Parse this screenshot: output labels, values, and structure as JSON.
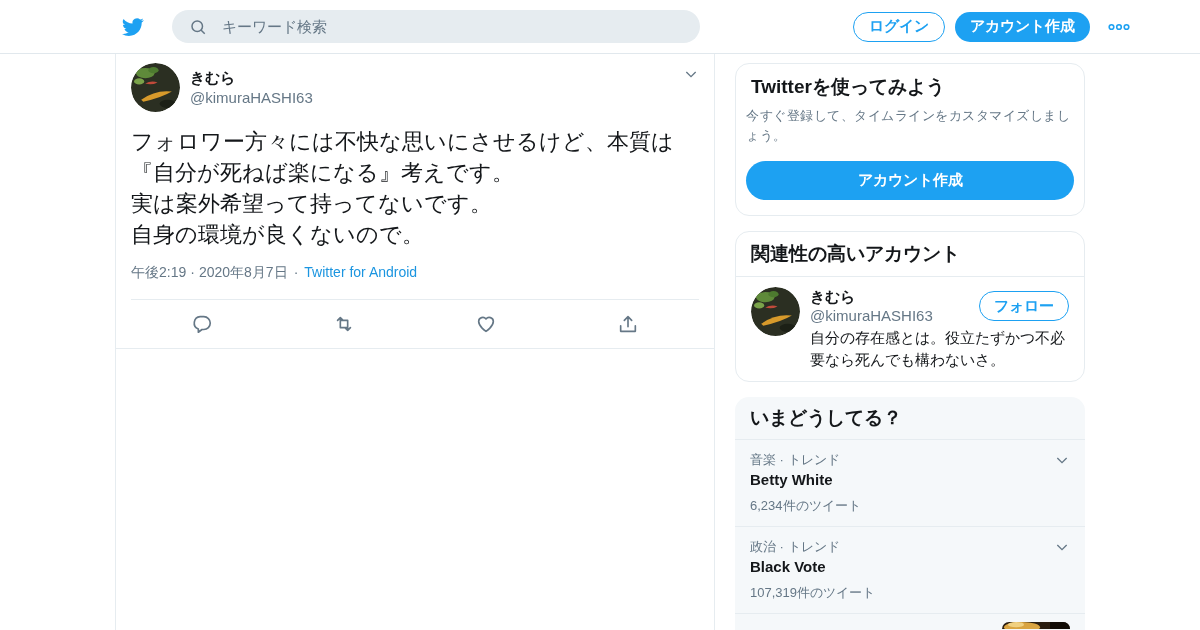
{
  "header": {
    "search": {
      "placeholder": "キーワード検索"
    },
    "login_button": "ログイン",
    "signup_button": "アカウント作成"
  },
  "tweet": {
    "name": "きむら",
    "handle": "@kimuraHASHI63",
    "lines": [
      "フォロワー方々には不快な思いにさせるけど、本質は",
      "『自分が死ねば楽になる』考えです。",
      "実は案外希望って持ってないです。",
      "自身の環境が良くないので。"
    ],
    "time": "午後2:19",
    "separator": "·",
    "date": "2020年8月7日",
    "source": "Twitter for Android"
  },
  "signup_card": {
    "title": "Twitterを使ってみよう",
    "text": "今すぐ登録して、タイムラインをカスタマイズしましょう。",
    "button": "アカウント作成"
  },
  "related_card": {
    "title": "関連性の高いアカウント",
    "accounts": [
      {
        "name": "きむら",
        "handle": "@kimuraHASHI63",
        "bio": "自分の存在感とは。役立たずかつ不必要なら死んでも構わないさ。",
        "button": "フォロー"
      }
    ]
  },
  "trends_card": {
    "title": "いまどうしてる？",
    "trends": [
      {
        "kind": "text",
        "context": "音楽 · トレンド",
        "name": "Betty White",
        "count": "6,234件のツイート"
      },
      {
        "kind": "text",
        "context": "政治 · トレンド",
        "name": "Black Vote",
        "count": "107,319件のツイート"
      },
      {
        "kind": "picture"
      }
    ]
  }
}
